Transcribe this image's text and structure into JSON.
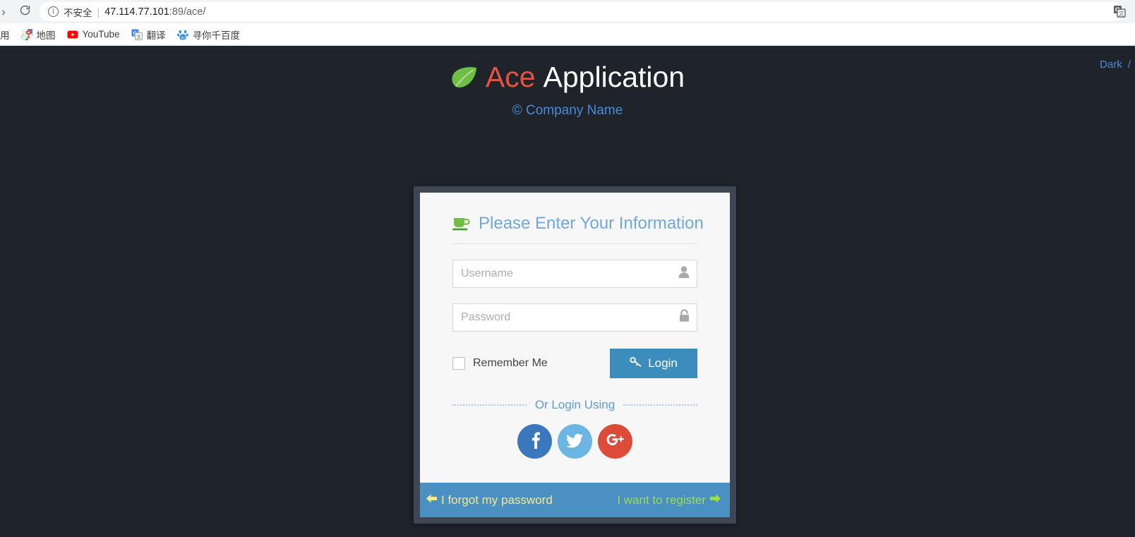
{
  "browser": {
    "forward_icon": "forward-arrow-icon",
    "reload_icon": "reload-icon",
    "security_label": "不安全",
    "security_icon": "info-circle-icon",
    "separator": "|",
    "url_host": "47.114.77.101",
    "url_path": ":89/ace/",
    "translate_icon": "google-translate-icon",
    "bookmarks": [
      {
        "label": "用",
        "icon": "partial-bookmark-icon"
      },
      {
        "label": "地图",
        "icon": "google-maps-icon"
      },
      {
        "label": "YouTube",
        "icon": "youtube-icon"
      },
      {
        "label": "翻译",
        "icon": "google-translate-icon"
      },
      {
        "label": "寻你千百度",
        "icon": "baidu-icon"
      }
    ]
  },
  "page": {
    "background_color": "#1F232A",
    "theme_switcher": {
      "current": "Dark",
      "slash": "/"
    },
    "brand": {
      "logo_icon": "leaf-icon",
      "name_primary": "Ace",
      "name_secondary": "Application",
      "subtitle": "© Company Name",
      "primary_color": "#E4533F",
      "subtitle_color": "#4B8BD6"
    },
    "login_card": {
      "heading_icon": "coffee-cup-icon",
      "heading": "Please Enter Your Information",
      "heading_color": "#6FA8DC",
      "fields": [
        {
          "name": "username",
          "placeholder": "Username",
          "value": "",
          "type": "text",
          "icon": "user-icon"
        },
        {
          "name": "password",
          "placeholder": "Password",
          "value": "",
          "type": "password",
          "icon": "lock-icon"
        }
      ],
      "remember_me": {
        "label": "Remember Me",
        "checked": false
      },
      "login_button": {
        "label": "Login",
        "icon": "key-icon",
        "color": "#3C8DBC"
      },
      "or_divider_text": "Or Login Using",
      "social_buttons": [
        {
          "name": "facebook",
          "icon": "facebook-icon",
          "color": "#3B77BD"
        },
        {
          "name": "twitter",
          "icon": "twitter-icon",
          "color": "#6CB6E4"
        },
        {
          "name": "googleplus",
          "icon": "google-plus-icon",
          "color": "#DD4B39"
        }
      ],
      "footer": {
        "background_color": "#4A90C2",
        "forgot_password": {
          "label": "I forgot my password",
          "icon": "arrow-left-icon",
          "color": "#F7E98E"
        },
        "register": {
          "label": "I want to register",
          "icon": "arrow-right-icon",
          "color": "#9BDE4F"
        }
      }
    }
  }
}
